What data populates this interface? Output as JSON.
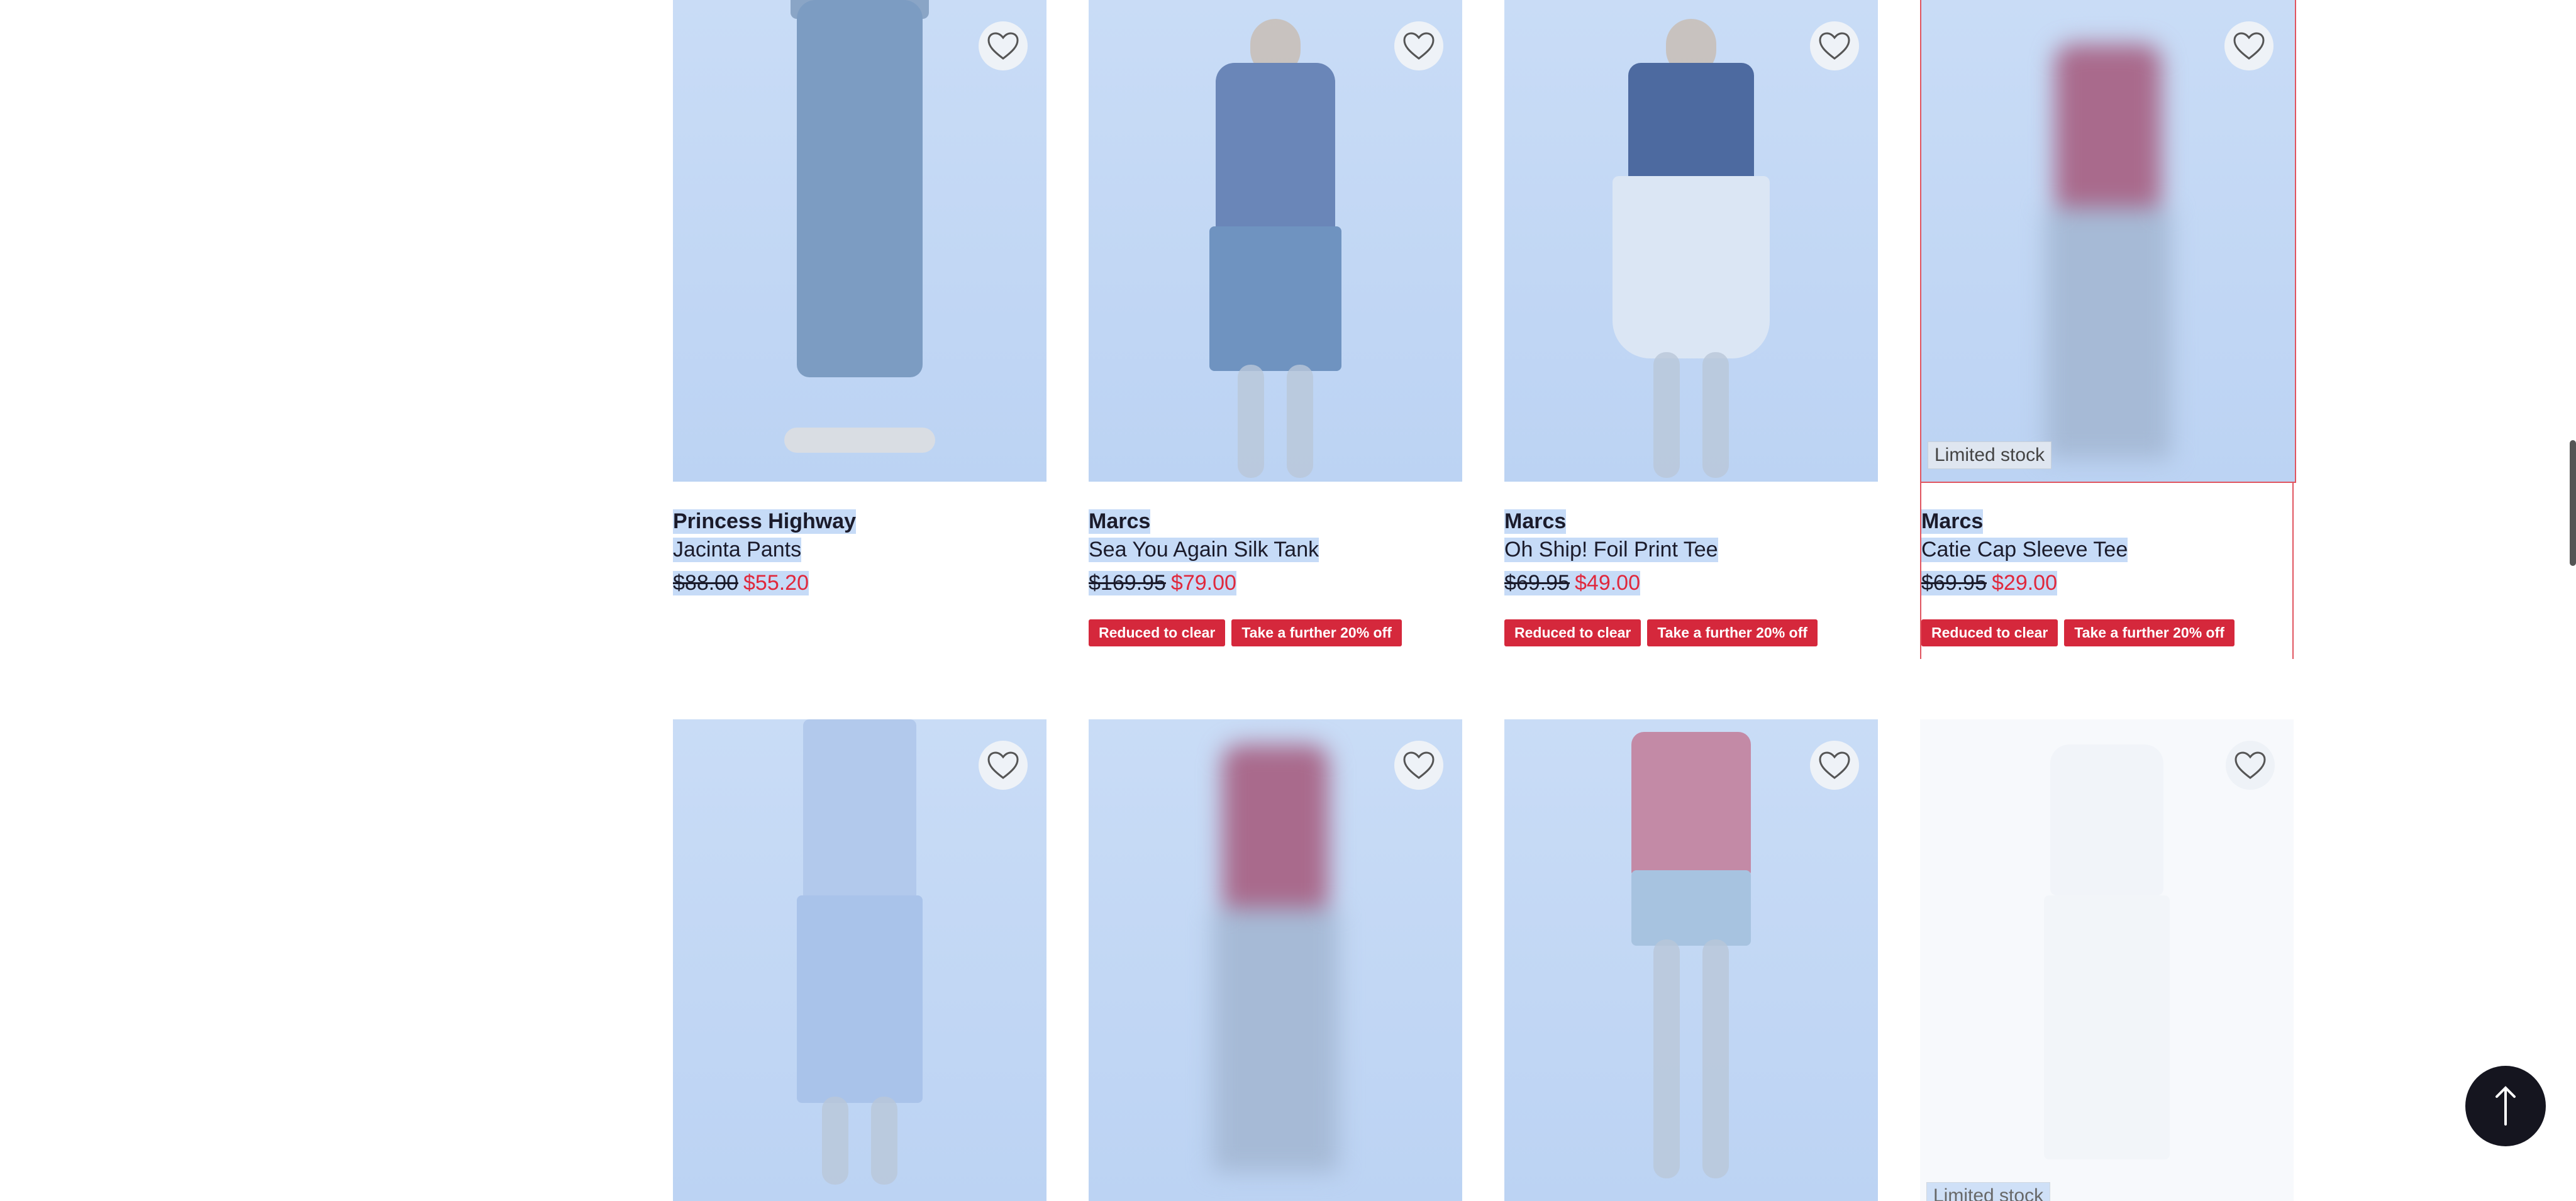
{
  "products_row1": [
    {
      "brand": "Princess Highway",
      "name": "Jacinta Pants",
      "was": "$88.00",
      "now": "$55.20",
      "badges": [],
      "stock": ""
    },
    {
      "brand": "Marcs",
      "name": "Sea You Again Silk Tank",
      "was": "$169.95",
      "now": "$79.00",
      "badges": [
        "Reduced to clear",
        "Take a further 20% off"
      ],
      "stock": ""
    },
    {
      "brand": "Marcs",
      "name": "Oh Ship! Foil Print Tee",
      "was": "$69.95",
      "now": "$49.00",
      "badges": [
        "Reduced to clear",
        "Take a further 20% off"
      ],
      "stock": ""
    },
    {
      "brand": "Marcs",
      "name": "Catie Cap Sleeve Tee",
      "was": "$69.95",
      "now": "$29.00",
      "badges": [
        "Reduced to clear",
        "Take a further 20% off"
      ],
      "stock": "Limited stock"
    }
  ],
  "products_row2_stock": "Limited stock",
  "icons": {
    "wishlist": "heart-outline-icon",
    "back_to_top": "arrow-up-icon"
  },
  "colors": {
    "sale_price": "#e0283c",
    "badge_bg": "#d5283c",
    "selection_highlight": "#c6dbf7"
  }
}
